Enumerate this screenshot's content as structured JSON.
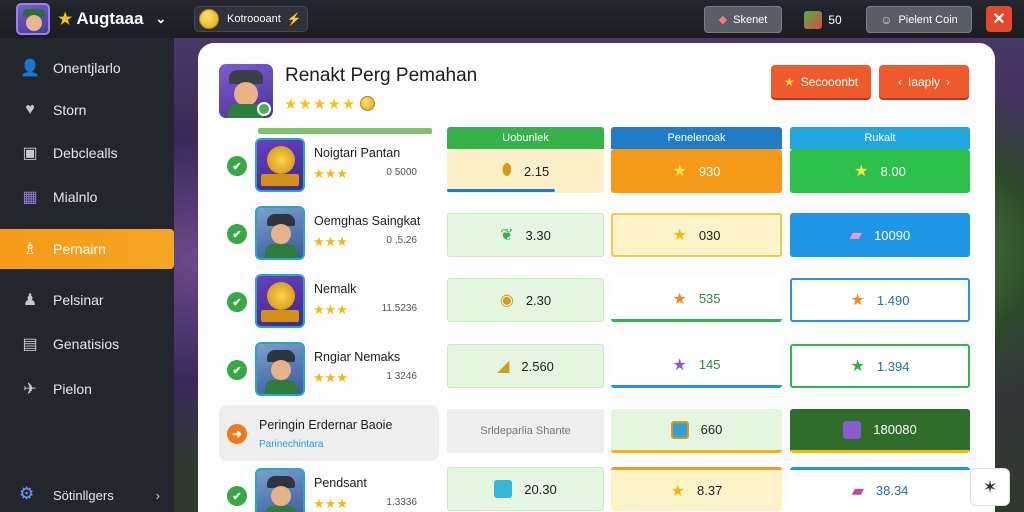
{
  "topbar": {
    "brand": "Augtaaa",
    "coin_text": "Kotroooant",
    "secure_label": "Skenet",
    "count_value": "50",
    "user_label": "Pielent Coin",
    "close_label": "✕"
  },
  "sidebar": {
    "items": [
      {
        "label": "Onentjlarlo",
        "icon": "user-circle-icon",
        "glyph": "👤"
      },
      {
        "label": "Storn",
        "icon": "heart-badge-icon",
        "glyph": "♥"
      },
      {
        "label": "Debclealls",
        "icon": "folder-icon",
        "glyph": "▣"
      },
      {
        "label": "Mialnlo",
        "icon": "game-thumb-icon",
        "glyph": "▦"
      },
      {
        "label": "Pernairn",
        "icon": "people-icon",
        "glyph": "♗"
      },
      {
        "label": "Pelsinar",
        "icon": "person-icon",
        "glyph": "♟"
      },
      {
        "label": "Genatisios",
        "icon": "clipboard-icon",
        "glyph": "▤"
      },
      {
        "label": "Pielon",
        "icon": "send-icon",
        "glyph": "✈"
      }
    ],
    "footer": {
      "label": "Sötinllgers",
      "icon": "gear-icon"
    }
  },
  "panel": {
    "title": "Renakt Perg Pemahan",
    "stars": "★★★★★",
    "buttons": {
      "secondary": "Secooonbt",
      "apply": "Iaaply",
      "apply_prev": "‹",
      "apply_next": "›"
    },
    "columns": [
      "Uobunlek",
      "Penelenoak",
      "Rukalt"
    ],
    "rows": [
      {
        "name": "Noigtari Pantan",
        "stars": "★★★",
        "value": "0 5000",
        "cells": [
          "2.15",
          "930",
          "8.00"
        ]
      },
      {
        "name": "Oemghas Saingkat",
        "stars": "★★★",
        "value": "0 ,5.26",
        "cells": [
          "3.30",
          "030",
          "10090"
        ]
      },
      {
        "name": "Nemalk",
        "stars": "★★★",
        "value": "11.5236",
        "cells": [
          "2.30",
          "535",
          "1.490"
        ]
      },
      {
        "name": "Rngiar Nemaks",
        "stars": "★★★",
        "value": "1 3246",
        "cells": [
          "2.560",
          "145",
          "1.394"
        ]
      },
      {
        "name": "Peringin Erdernar Baoie",
        "sub": "Parinechintara",
        "cells": [
          "Srldeparlia Shante",
          "660",
          "180080"
        ]
      },
      {
        "name": "Pendsant",
        "stars": "★★★",
        "value": "1.3336",
        "cells": [
          "20.30",
          "8.37",
          "38.34"
        ]
      }
    ]
  },
  "colors": {
    "accent_orange": "#f5a623",
    "button_red": "#ef5a2c",
    "green": "#37a845",
    "blue": "#1f95e6",
    "orange_cell": "#f59a17"
  }
}
